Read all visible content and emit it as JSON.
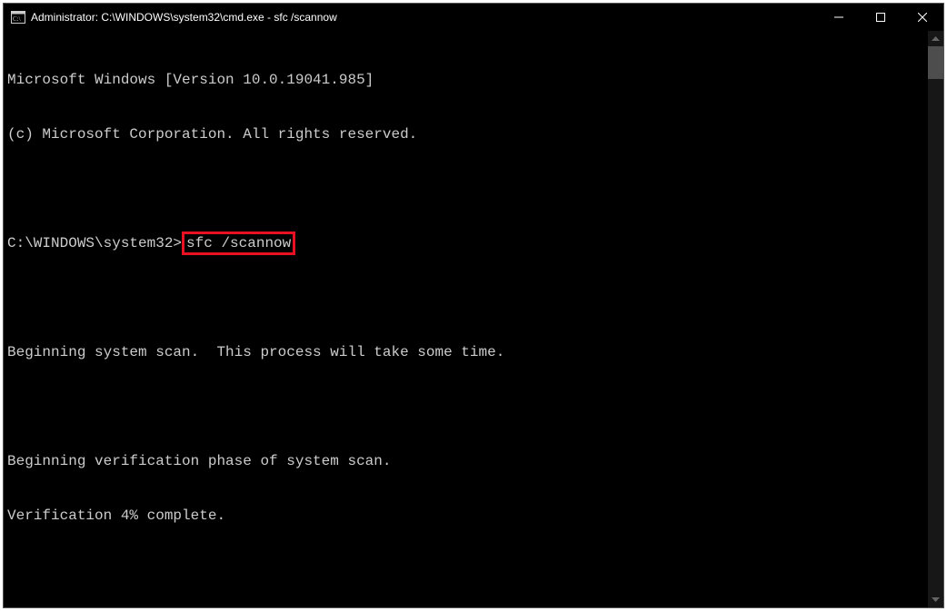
{
  "titlebar": {
    "title": "Administrator: C:\\WINDOWS\\system32\\cmd.exe - sfc  /scannow"
  },
  "terminal": {
    "line1": "Microsoft Windows [Version 10.0.19041.985]",
    "line2": "(c) Microsoft Corporation. All rights reserved.",
    "blank1": "",
    "prompt": "C:\\WINDOWS\\system32>",
    "command": "sfc /scannow",
    "blank2": "",
    "line4": "Beginning system scan.  This process will take some time.",
    "blank3": "",
    "line5": "Beginning verification phase of system scan.",
    "line6": "Verification 4% complete."
  },
  "colors": {
    "highlight": "#e81123",
    "bg": "#000000",
    "fg": "#cccccc"
  }
}
